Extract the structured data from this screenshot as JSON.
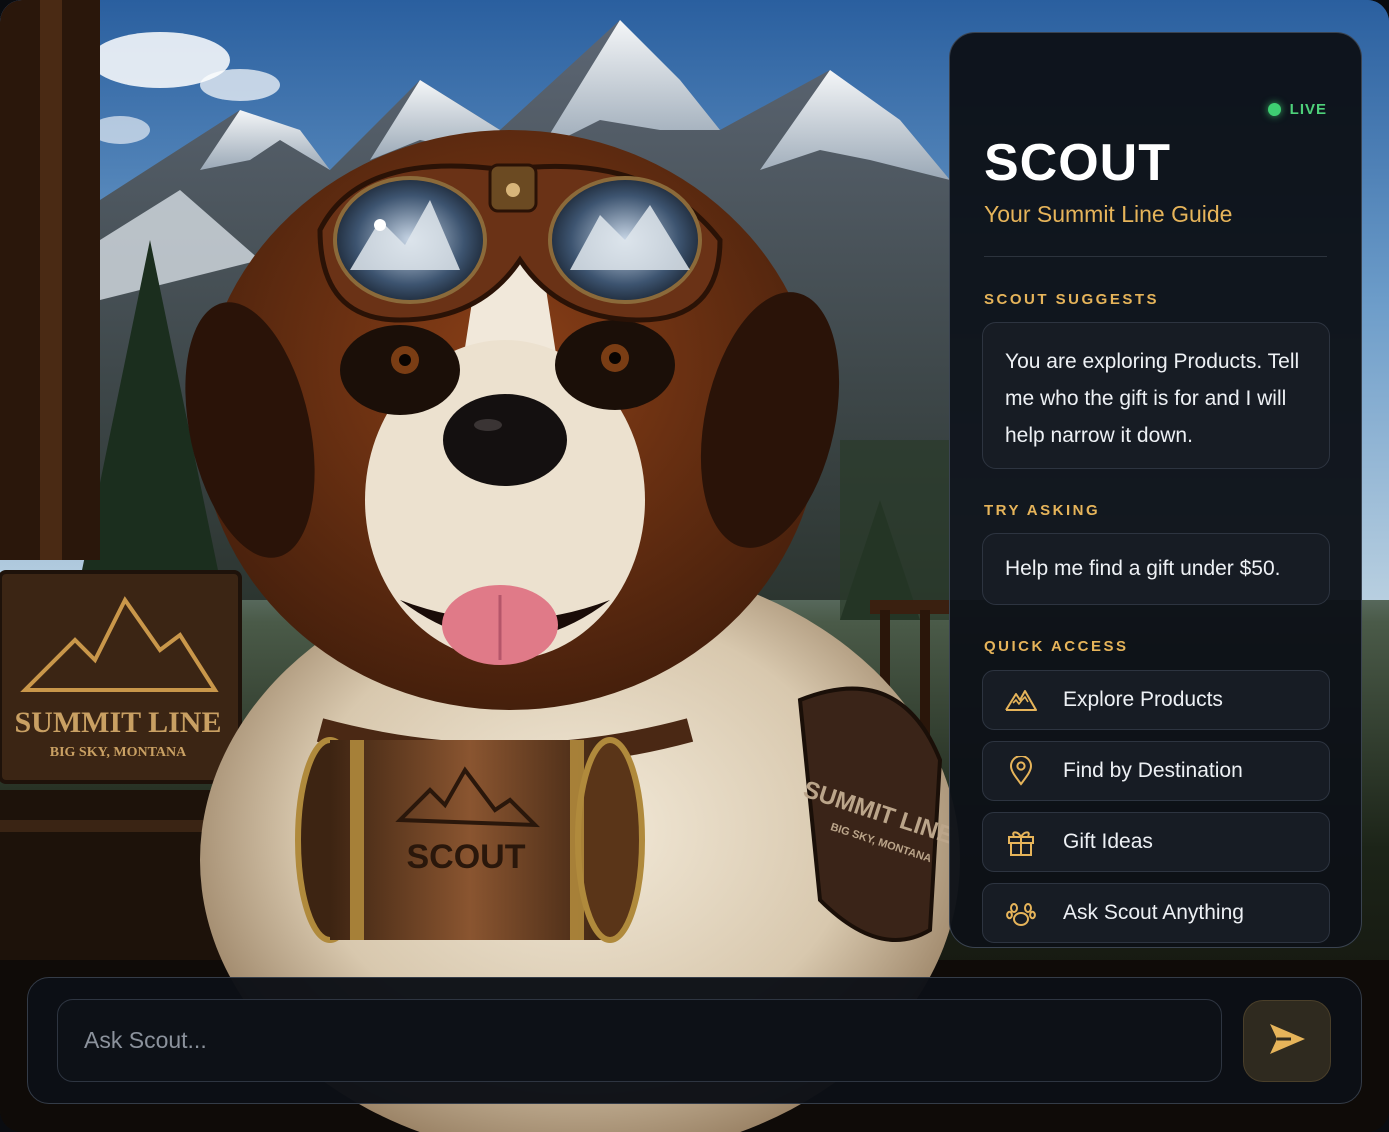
{
  "panel": {
    "status": "LIVE",
    "title": "SCOUT",
    "subtitle": "Your Summit Line Guide",
    "suggest_label": "SCOUT SUGGESTS",
    "suggest_text": "You are exploring Products. Tell me who the gift is for and I will help narrow it down.",
    "try_label": "TRY ASKING",
    "try_text": "Help me find a gift under $50.",
    "quick_label": "QUICK ACCESS",
    "quick_items": [
      {
        "label": "Explore Products",
        "icon": "mountain-icon"
      },
      {
        "label": "Find by Destination",
        "icon": "location-pin-icon"
      },
      {
        "label": "Gift Ideas",
        "icon": "gift-icon"
      },
      {
        "label": "Ask Scout Anything",
        "icon": "paw-icon"
      }
    ]
  },
  "scene": {
    "sign_line1": "SUMMIT LINE",
    "sign_line2": "BIG SKY, MONTANA",
    "barrel_text": "SCOUT",
    "vest_line1": "SUMMIT LINE",
    "vest_line2": "BIG SKY, MONTANA"
  },
  "input": {
    "placeholder": "Ask Scout...",
    "value": ""
  },
  "colors": {
    "accent": "#e6b45a",
    "live": "#3ecf72",
    "panel_bg": "#0d1117"
  }
}
